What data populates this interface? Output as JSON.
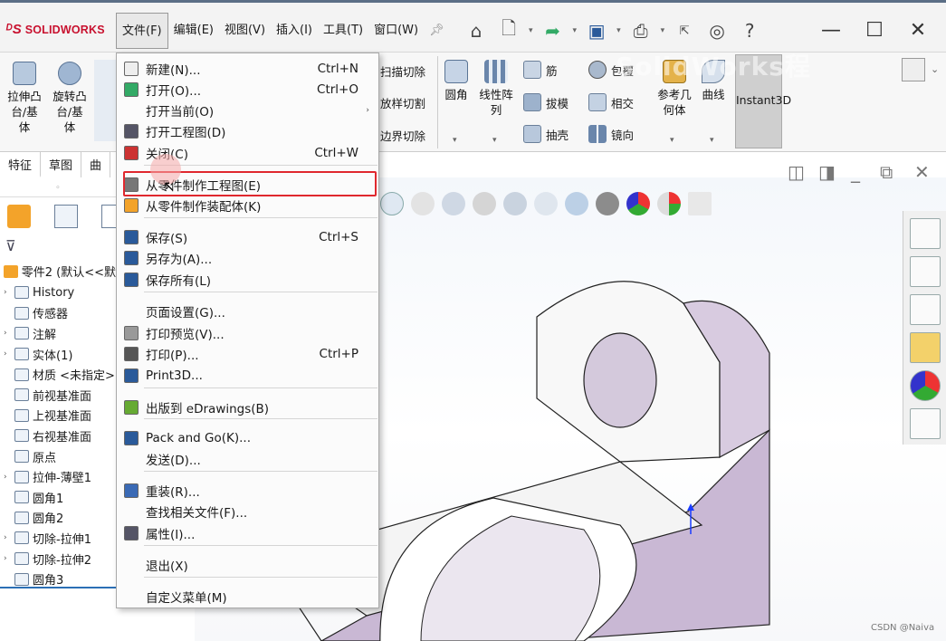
{
  "app": {
    "logo": "SOLIDWORKS",
    "watermark": "SolidWorks程"
  },
  "menubar": [
    "文件(F)",
    "编辑(E)",
    "视图(V)",
    "插入(I)",
    "工具(T)",
    "窗口(W)"
  ],
  "ribbon": {
    "left_buttons": [
      {
        "label": "拉伸凸\n台/基\n体"
      },
      {
        "label": "旋转凸\n台/基\n体"
      }
    ],
    "col2": [
      "扫描切除",
      "放样切割",
      "边界切除"
    ],
    "col3_big": [
      {
        "label": "圆角"
      },
      {
        "label": "线性阵\n列"
      }
    ],
    "col4": [
      "筋",
      "拔模",
      "抽壳"
    ],
    "col5": [
      "包覆",
      "相交",
      "镜向"
    ],
    "col6_big": [
      {
        "label": "参考几\n何体"
      },
      {
        "label": "曲线"
      }
    ],
    "instant3d": "Instant3D"
  },
  "tabs": [
    "特征",
    "草图",
    "曲"
  ],
  "tree": {
    "root": "零件2  (默认<<默",
    "items": [
      {
        "label": "History",
        "arrow": "›"
      },
      {
        "label": "传感器",
        "arrow": ""
      },
      {
        "label": "注解",
        "arrow": "›"
      },
      {
        "label": "实体(1)",
        "arrow": "›"
      },
      {
        "label": "材质 <未指定>",
        "arrow": ""
      },
      {
        "label": "前视基准面",
        "arrow": ""
      },
      {
        "label": "上视基准面",
        "arrow": ""
      },
      {
        "label": "右视基准面",
        "arrow": ""
      },
      {
        "label": "原点",
        "arrow": ""
      },
      {
        "label": "拉伸-薄壁1",
        "arrow": "›"
      },
      {
        "label": "圆角1",
        "arrow": ""
      },
      {
        "label": "圆角2",
        "arrow": ""
      },
      {
        "label": "切除-拉伸1",
        "arrow": "›"
      },
      {
        "label": "切除-拉伸2",
        "arrow": "›"
      },
      {
        "label": "圆角3",
        "arrow": ""
      }
    ]
  },
  "file_menu": {
    "items": [
      {
        "label": "新建(N)...",
        "shortcut": "Ctrl+N",
        "icon": "new-doc-icon"
      },
      {
        "label": "打开(O)...",
        "shortcut": "Ctrl+O",
        "icon": "open-icon"
      },
      {
        "label": "打开当前(O)",
        "shortcut": "",
        "icon": "",
        "submenu": "›"
      },
      {
        "label": "打开工程图(D)",
        "shortcut": "",
        "icon": "open-drawing-icon"
      },
      {
        "label": "关闭(C)",
        "shortcut": "Ctrl+W",
        "icon": "close-doc-icon"
      },
      {
        "label": "从零件制作工程图(E)",
        "shortcut": "",
        "icon": "make-drawing-icon"
      },
      {
        "label": "从零件制作装配体(K)",
        "shortcut": "",
        "icon": "make-assembly-icon"
      },
      {
        "label": "保存(S)",
        "shortcut": "Ctrl+S",
        "icon": "save-icon"
      },
      {
        "label": "另存为(A)...",
        "shortcut": "",
        "icon": "save-as-icon"
      },
      {
        "label": "保存所有(L)",
        "shortcut": "",
        "icon": "save-all-icon"
      },
      {
        "label": "页面设置(G)...",
        "shortcut": "",
        "icon": ""
      },
      {
        "label": "打印预览(V)...",
        "shortcut": "",
        "icon": "print-preview-icon"
      },
      {
        "label": "打印(P)...",
        "shortcut": "Ctrl+P",
        "icon": "print-icon"
      },
      {
        "label": "Print3D...",
        "shortcut": "",
        "icon": "print3d-icon"
      },
      {
        "label": "出版到 eDrawings(B)",
        "shortcut": "",
        "icon": "edrawings-icon"
      },
      {
        "label": "Pack and Go(K)...",
        "shortcut": "",
        "icon": "pack-and-go-icon"
      },
      {
        "label": "发送(D)...",
        "shortcut": "",
        "icon": ""
      },
      {
        "label": "重装(R)...",
        "shortcut": "",
        "icon": "reload-icon"
      },
      {
        "label": "查找相关文件(F)...",
        "shortcut": "",
        "icon": ""
      },
      {
        "label": "属性(I)...",
        "shortcut": "",
        "icon": "properties-icon"
      },
      {
        "label": "退出(X)",
        "shortcut": "",
        "icon": ""
      },
      {
        "label": "自定义菜单(M)",
        "shortcut": "",
        "icon": ""
      }
    ]
  },
  "credit": "CSDN @Naiva",
  "colors": {
    "highlight": "#e0282e",
    "brand": "#c8102e"
  }
}
